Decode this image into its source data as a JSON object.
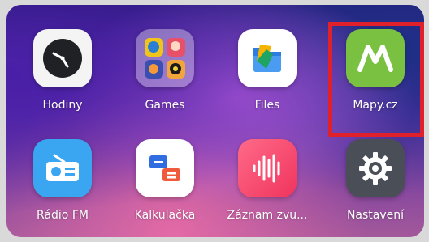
{
  "apps": [
    {
      "label": "Hodiny",
      "icon": "clock-icon"
    },
    {
      "label": "Games",
      "icon": "games-folder-icon"
    },
    {
      "label": "Files",
      "icon": "files-icon"
    },
    {
      "label": "Mapy.cz",
      "icon": "mapy-icon"
    },
    {
      "label": "Rádio FM",
      "icon": "radio-icon"
    },
    {
      "label": "Kalkulačka",
      "icon": "calculator-icon"
    },
    {
      "label": "Záznam zvu...",
      "icon": "sound-recorder-icon"
    },
    {
      "label": "Nastavení",
      "icon": "settings-gear-icon"
    }
  ],
  "highlight_color": "#e0212b"
}
